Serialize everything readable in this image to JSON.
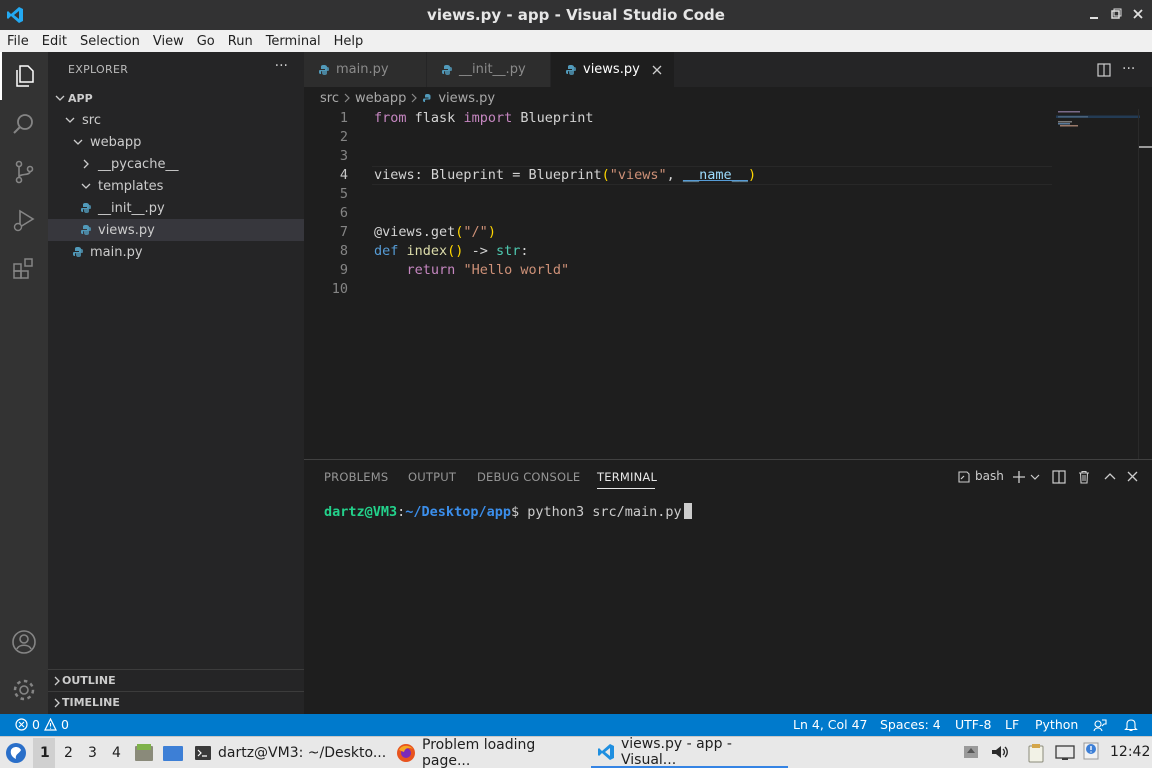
{
  "window": {
    "title": "views.py - app - Visual Studio Code"
  },
  "menu": [
    "File",
    "Edit",
    "Selection",
    "View",
    "Go",
    "Run",
    "Terminal",
    "Help"
  ],
  "sidebar": {
    "header": "EXPLORER",
    "more": "···",
    "root": "APP",
    "tree": [
      {
        "label": "src",
        "kind": "folder",
        "open": true
      },
      {
        "label": "webapp",
        "kind": "folder",
        "open": true
      },
      {
        "label": "__pycache__",
        "kind": "folder",
        "open": false
      },
      {
        "label": "templates",
        "kind": "folder",
        "open": true
      },
      {
        "label": "__init__.py",
        "kind": "python"
      },
      {
        "label": "views.py",
        "kind": "python",
        "selected": true
      },
      {
        "label": "main.py",
        "kind": "python"
      }
    ],
    "outline": "OUTLINE",
    "timeline": "TIMELINE"
  },
  "tabs": [
    {
      "label": "main.py",
      "active": false
    },
    {
      "label": "__init__.py",
      "active": false
    },
    {
      "label": "views.py",
      "active": true
    }
  ],
  "breadcrumb": [
    "src",
    "webapp",
    "views.py"
  ],
  "editor": {
    "line_numbers": [
      "1",
      "2",
      "3",
      "4",
      "5",
      "6",
      "7",
      "8",
      "9",
      "10"
    ],
    "current_line": "4",
    "code": {
      "l1_from": "from",
      "l1_mod": "flask",
      "l1_import": "import",
      "l1_name": "Blueprint",
      "l4_var": "views",
      "l4_colon": ": ",
      "l4_type": "Blueprint",
      "l4_eq": " = ",
      "l4_call": "Blueprint",
      "l4_lp": "(",
      "l4_str": "\"views\"",
      "l4_comma": ", ",
      "l4_dunder": "__name__",
      "l4_rp": ")",
      "l7_at": "@views.get",
      "l7_lp": "(",
      "l7_str": "\"/\"",
      "l7_rp": ")",
      "l8_def": "def",
      "l8_fn": "index",
      "l8_parens": "()",
      "l8_arrow": " -> ",
      "l8_type": "str",
      "l8_colon": ":",
      "l9_ret": "return",
      "l9_str": "\"Hello world\""
    }
  },
  "panel": {
    "tabs": [
      "PROBLEMS",
      "OUTPUT",
      "DEBUG CONSOLE",
      "TERMINAL"
    ],
    "active_tab": "TERMINAL",
    "shell": "bash",
    "terminal": {
      "user": "dartz@VM3",
      "colon": ":",
      "path": "~/Desktop/app",
      "prompt": "$ ",
      "command": "python3 src/main.py"
    }
  },
  "status": {
    "errors": "0",
    "warnings": "0",
    "position": "Ln 4, Col 47",
    "spaces": "Spaces: 4",
    "encoding": "UTF-8",
    "eol": "LF",
    "language": "Python"
  },
  "taskbar": {
    "workspaces": [
      "1",
      "2",
      "3",
      "4"
    ],
    "tasks": [
      {
        "label": "dartz@VM3: ~/Deskto...",
        "icon": "terminal-icon"
      },
      {
        "label": "Problem loading page...",
        "icon": "firefox-icon"
      },
      {
        "label": "views.py - app - Visual...",
        "icon": "vscode-icon",
        "active": true
      }
    ],
    "clock": "12:42"
  },
  "colors": {
    "accent": "#007acc",
    "activity_bg": "#333333",
    "sidebar_bg": "#252526",
    "editor_bg": "#1e1e1e"
  }
}
